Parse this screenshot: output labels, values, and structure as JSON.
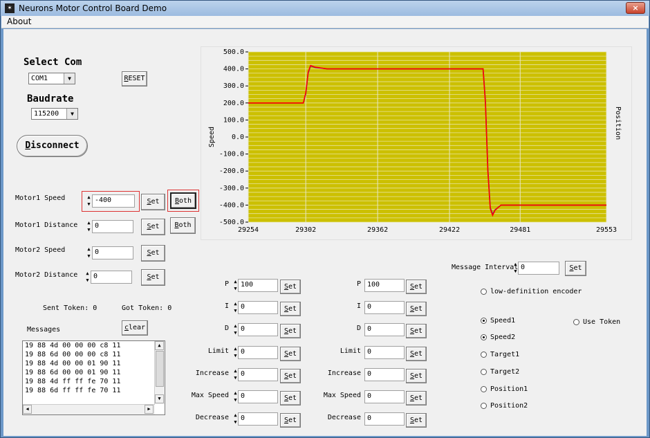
{
  "window": {
    "title": "Neurons Motor Control Board Demo",
    "close_label": "×"
  },
  "menu": {
    "about": "About"
  },
  "connection": {
    "select_com_label": "Select Com",
    "com_value": "COM1",
    "reset_label": "RESET",
    "baudrate_label": "Baudrate",
    "baud_value": "115200",
    "disconnect_label": "Disconnect"
  },
  "motors": [
    {
      "label": "Motor1 Speed",
      "value": "-400",
      "set": "Set",
      "both": "Both"
    },
    {
      "label": "Motor1 Distance",
      "value": "0",
      "set": "Set",
      "both": "Both"
    },
    {
      "label": "Motor2 Speed",
      "value": "0",
      "set": "Set"
    },
    {
      "label": "Motor2 Distance",
      "value": "0",
      "set": "Set"
    }
  ],
  "tokens": {
    "sent": "Sent Token: 0",
    "got": "Got Token: 0"
  },
  "messages": {
    "label": "Messages",
    "clear_label": "clear",
    "lines": [
      "19 88 4d 00 00 00 c8 11",
      "19 88 6d 00 00 00 c8 11",
      "19 88 4d 00 00 01 90 11",
      "19 88 6d 00 00 01 90 11",
      "19 88 4d ff ff fe 70 11",
      "19 88 6d ff ff fe 70 11"
    ]
  },
  "pid_left": [
    {
      "label": "P",
      "value": "100",
      "set": "Set"
    },
    {
      "label": "I",
      "value": "0",
      "set": "Set"
    },
    {
      "label": "D",
      "value": "0",
      "set": "Set"
    },
    {
      "label": "Limit",
      "value": "0",
      "set": "Set"
    },
    {
      "label": "Increase",
      "value": "0",
      "set": "Set"
    },
    {
      "label": "Max Speed",
      "value": "0",
      "set": "Set"
    },
    {
      "label": "Decrease",
      "value": "0",
      "set": "Set"
    }
  ],
  "pid_right": [
    {
      "label": "P",
      "value": "100",
      "set": "Set"
    },
    {
      "label": "I",
      "value": "0",
      "set": "Set"
    },
    {
      "label": "D",
      "value": "0",
      "set": "Set"
    },
    {
      "label": "Limit",
      "value": "0",
      "set": "Set"
    },
    {
      "label": "Increase",
      "value": "0",
      "set": "Set"
    },
    {
      "label": "Max Speed",
      "value": "0",
      "set": "Set"
    },
    {
      "label": "Decrease",
      "value": "0",
      "set": "Set"
    }
  ],
  "options": {
    "message_interval_label": "Message Interval",
    "message_interval_value": "0",
    "set_label": "Set",
    "low_def_label": "low-definition encoder",
    "use_token_label": "Use Token",
    "plots": [
      {
        "label": "Speed1",
        "checked": true
      },
      {
        "label": "Speed2",
        "checked": true
      },
      {
        "label": "Target1",
        "checked": false
      },
      {
        "label": "Target2",
        "checked": false
      },
      {
        "label": "Position1",
        "checked": false
      },
      {
        "label": "Position2",
        "checked": false
      }
    ]
  },
  "chart_data": {
    "type": "line",
    "ylabel": "Speed",
    "y2label": "Position",
    "xlim": [
      29254,
      29553
    ],
    "ylim": [
      -500,
      500
    ],
    "x_ticks": [
      "29254",
      "29302",
      "29362",
      "29422",
      "29481",
      "29553"
    ],
    "y_ticks": [
      "500.0",
      "400.0",
      "300.0",
      "200.0",
      "100.0",
      "0.0",
      "-100.0",
      "-200.0",
      "-300.0",
      "-400.0",
      "-500.0"
    ],
    "colors": {
      "background": "#ccc000",
      "speed1": "#ff0000",
      "speed2": "#3030c0",
      "grid": "#e8e4a0"
    },
    "series": [
      {
        "x": [
          29254,
          29300,
          29302,
          29304,
          29306,
          29310,
          29320,
          29400,
          29450,
          29452,
          29454,
          29456,
          29458,
          29460,
          29465,
          29470,
          29500,
          29553
        ],
        "y": [
          200,
          200,
          260,
          380,
          420,
          410,
          400,
          400,
          400,
          200,
          -200,
          -420,
          -460,
          -430,
          -400,
          -400,
          -400,
          -400
        ]
      },
      {
        "x": [
          29254,
          29300,
          29302,
          29304,
          29306,
          29310,
          29320,
          29400,
          29450,
          29452,
          29454,
          29456,
          29458,
          29460,
          29465,
          29470,
          29500,
          29553
        ],
        "y": [
          200,
          200,
          255,
          375,
          418,
          408,
          400,
          400,
          400,
          210,
          -190,
          -415,
          -455,
          -428,
          -400,
          -400,
          -400,
          -400
        ]
      }
    ]
  }
}
